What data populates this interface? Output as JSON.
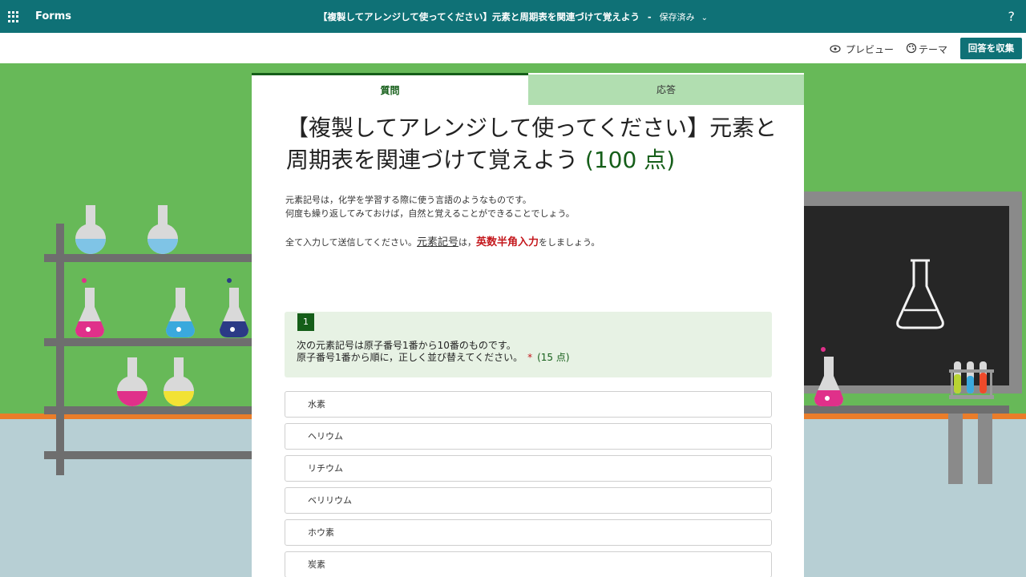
{
  "topbar": {
    "app_name": "Forms",
    "doc_title": "【複製してアレンジして使ってください】元素と周期表を関連づけて覚えよう",
    "separator": "-",
    "save_status": "保存済み",
    "help_label": "?"
  },
  "commands": {
    "preview_label": "プレビュー",
    "theme_label": "テーマ",
    "collect_label": "回答を収集"
  },
  "tabs": {
    "questions": "質問",
    "responses": "応答"
  },
  "form": {
    "title": "【複製してアレンジして使ってください】元素と周期表を関連づけて覚えよう",
    "points": "(100 点)",
    "desc_line1": "元素記号は，化学を学習する際に使う言語のようなものです。",
    "desc_line2": "何度も繰り返してみておけば，自然と覚えることができることでしょう。",
    "desc2_part1": "全て入力して送信してください。",
    "desc2_part2": "元素記号",
    "desc2_part3": "は，",
    "desc2_part4": "英数半角入力",
    "desc2_part5": "をしましょう。"
  },
  "question": {
    "number": "1",
    "line1": "次の元素記号は原子番号1番から10番のものです。",
    "line2": "原子番号1番から順に，正しく並び替えてください。",
    "required_mark": "*",
    "points": "(15 点)"
  },
  "options": [
    "水素",
    "ヘリウム",
    "リチウム",
    "ベリリウム",
    "ホウ素",
    "炭素"
  ],
  "colors": {
    "brand": "#0f7176",
    "accent_green": "#155e19",
    "required_red": "#c4171c"
  }
}
